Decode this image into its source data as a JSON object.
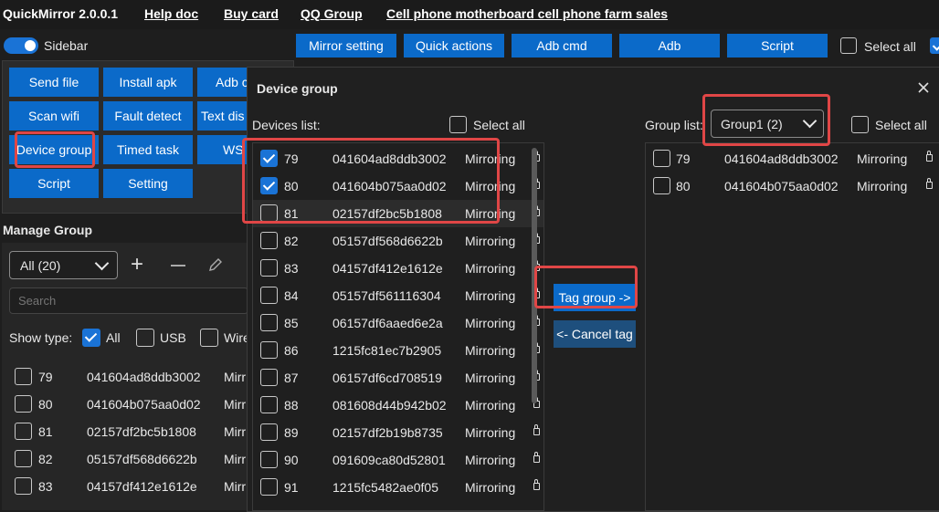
{
  "menubar": {
    "app_title": "QuickMirror 2.0.0.1",
    "links": [
      "Help doc",
      "Buy card",
      "QQ Group",
      "Cell phone motherboard cell phone farm sales"
    ]
  },
  "sidebar_toggle": {
    "label": "Sidebar",
    "on": true
  },
  "top_buttons": [
    "Mirror setting",
    "Quick actions",
    "Adb cmd",
    "Adb",
    "Script"
  ],
  "top_select_all": "Select all",
  "left_buttons": [
    "Send file",
    "Install apk",
    "Adb c",
    "Scan wifi",
    "Fault detect",
    "Text dis",
    "Device group",
    "Timed task",
    "WS",
    "Script",
    "Setting"
  ],
  "manage_group": {
    "title": "Manage Group",
    "filter_value": "All (20)",
    "search_placeholder": "Search",
    "show_type_label": "Show type:",
    "types": [
      {
        "label": "All",
        "checked": true
      },
      {
        "label": "USB",
        "checked": false
      },
      {
        "label": "Wire",
        "checked": false
      }
    ],
    "rows": [
      {
        "num": "79",
        "id": "041604ad8ddb3002",
        "status": "Mirr"
      },
      {
        "num": "80",
        "id": "041604b075aa0d02",
        "status": "Mirr"
      },
      {
        "num": "81",
        "id": "02157df2bc5b1808",
        "status": "Mirr"
      },
      {
        "num": "82",
        "id": "05157df568d6622b",
        "status": "Mirr"
      },
      {
        "num": "83",
        "id": "04157df412e1612e",
        "status": "Mirr"
      }
    ]
  },
  "dialog": {
    "title": "Device group",
    "devices_label": "Devices list:",
    "select_all": "Select all",
    "group_label": "Group list:",
    "group_value": "Group1 (2)",
    "tag_button": "Tag group ->",
    "cancel_button": "<- Cancel tag",
    "devices": [
      {
        "num": "79",
        "id": "041604ad8ddb3002",
        "status": "Mirroring",
        "checked": true
      },
      {
        "num": "80",
        "id": "041604b075aa0d02",
        "status": "Mirroring",
        "checked": true
      },
      {
        "num": "81",
        "id": "02157df2bc5b1808",
        "status": "Mirroring",
        "checked": false
      },
      {
        "num": "82",
        "id": "05157df568d6622b",
        "status": "Mirroring",
        "checked": false
      },
      {
        "num": "83",
        "id": "04157df412e1612e",
        "status": "Mirroring",
        "checked": false
      },
      {
        "num": "84",
        "id": "05157df561116304",
        "status": "Mirroring",
        "checked": false
      },
      {
        "num": "85",
        "id": "06157df6aaed6e2a",
        "status": "Mirroring",
        "checked": false
      },
      {
        "num": "86",
        "id": "1215fc81ec7b2905",
        "status": "Mirroring",
        "checked": false
      },
      {
        "num": "87",
        "id": "06157df6cd708519",
        "status": "Mirroring",
        "checked": false
      },
      {
        "num": "88",
        "id": "081608d44b942b02",
        "status": "Mirroring",
        "checked": false
      },
      {
        "num": "89",
        "id": "02157df2b19b8735",
        "status": "Mirroring",
        "checked": false
      },
      {
        "num": "90",
        "id": "091609ca80d52801",
        "status": "Mirroring",
        "checked": false
      },
      {
        "num": "91",
        "id": "1215fc5482ae0f05",
        "status": "Mirroring",
        "checked": false
      }
    ],
    "group_devices": [
      {
        "num": "79",
        "id": "041604ad8ddb3002",
        "status": "Mirroring"
      },
      {
        "num": "80",
        "id": "041604b075aa0d02",
        "status": "Mirroring"
      }
    ]
  },
  "colors": {
    "accent": "#0b6ac9",
    "highlight": "#e04646",
    "background": "#1e1e1e"
  }
}
